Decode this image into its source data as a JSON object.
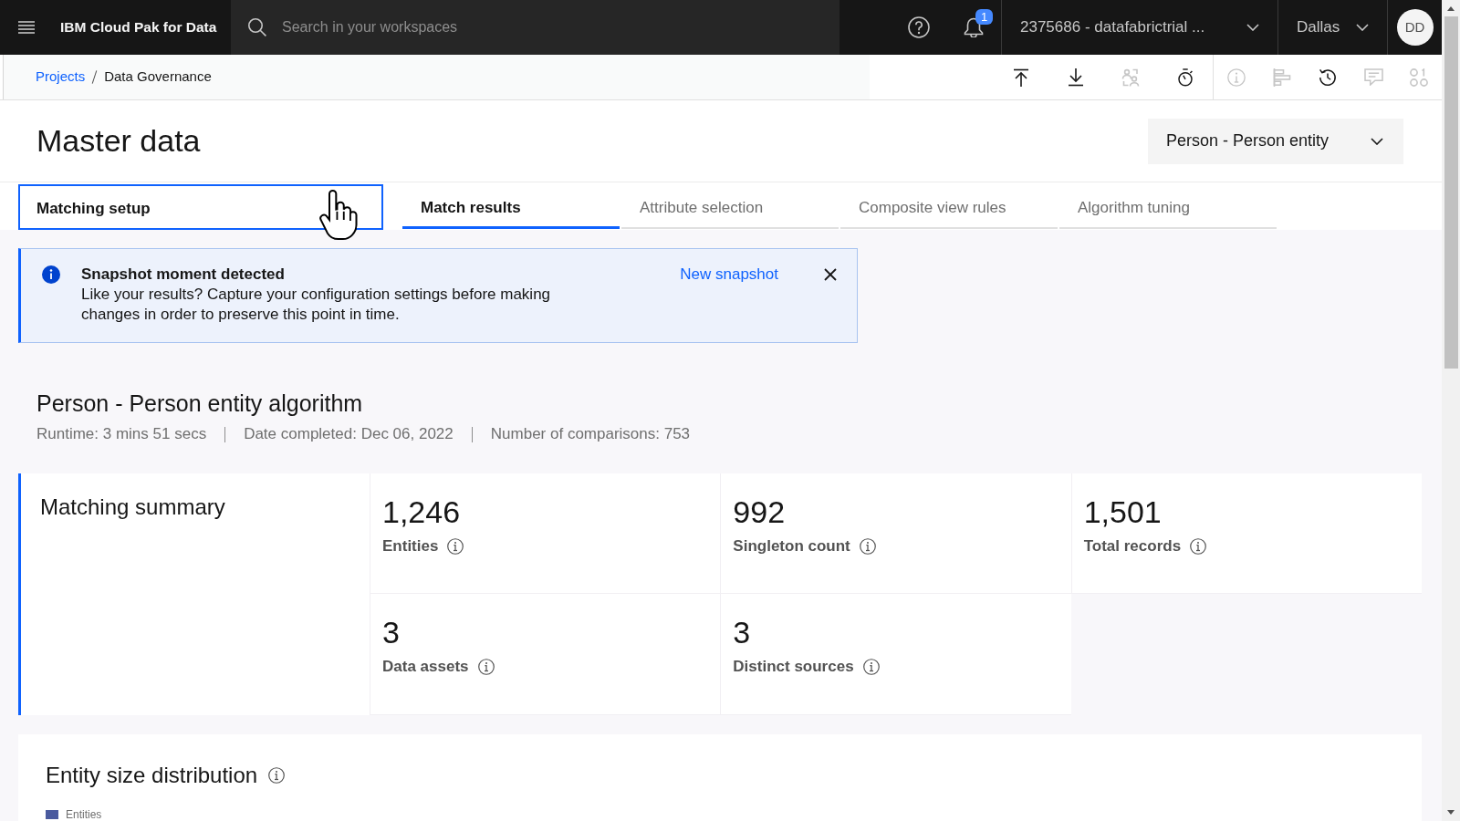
{
  "top_bar": {
    "product": "IBM Cloud Pak for Data",
    "search": {
      "placeholder": "Search in your workspaces"
    },
    "notification_count": "1",
    "account": "2375686 - datafabrictrial ...",
    "region": "Dallas",
    "avatar_initials": "DD"
  },
  "breadcrumb": [
    {
      "label": "Projects",
      "kind": "link"
    },
    {
      "label": "Data Governance",
      "kind": "current"
    }
  ],
  "toolbar_groups": [
    [
      {
        "kind": "upload",
        "disabled": false
      },
      {
        "kind": "download",
        "disabled": false
      },
      {
        "kind": "user_swap",
        "disabled": true
      },
      {
        "kind": "stopwatch",
        "disabled": false
      }
    ],
    [
      {
        "kind": "info",
        "disabled": true
      },
      {
        "kind": "align",
        "disabled": true
      },
      {
        "kind": "history",
        "disabled": false
      },
      {
        "kind": "comment",
        "disabled": true
      },
      {
        "kind": "apps",
        "disabled": true
      }
    ]
  ],
  "header": {
    "title": "Master data",
    "entity_select": {
      "value": "Person - Person entity"
    }
  },
  "setup_section": {
    "label": "Matching setup",
    "focused": true
  },
  "tabs": [
    {
      "label": "Match results",
      "selected": true
    },
    {
      "label": "Attribute selection",
      "selected": false
    },
    {
      "label": "Composite view rules",
      "selected": false
    },
    {
      "label": "Algorithm tuning",
      "selected": false
    }
  ],
  "notification": {
    "kind": "info",
    "title": "Snapshot moment detected",
    "message": "Like your results? Capture your configuration settings before making changes in order to preserve this point in time.",
    "action": "New snapshot"
  },
  "algorithm": {
    "title": "Person - Person entity algorithm",
    "details": [
      "Runtime: 3 mins 51 secs",
      "Date completed: Dec 06, 2022",
      "Number of comparisons: 753"
    ]
  },
  "matching_summary": {
    "title": "Matching summary",
    "metrics": [
      {
        "value": "1,246",
        "label": "Entities"
      },
      {
        "value": "992",
        "label": "Singleton count"
      },
      {
        "value": "1,501",
        "label": "Total records"
      },
      {
        "value": "3",
        "label": "Data assets"
      },
      {
        "value": "3",
        "label": "Distinct sources"
      }
    ]
  },
  "entity_size_distribution": {
    "title": "Entity size distribution",
    "legend": [
      {
        "label": "Entities",
        "color": "#4a5a9e"
      }
    ]
  }
}
